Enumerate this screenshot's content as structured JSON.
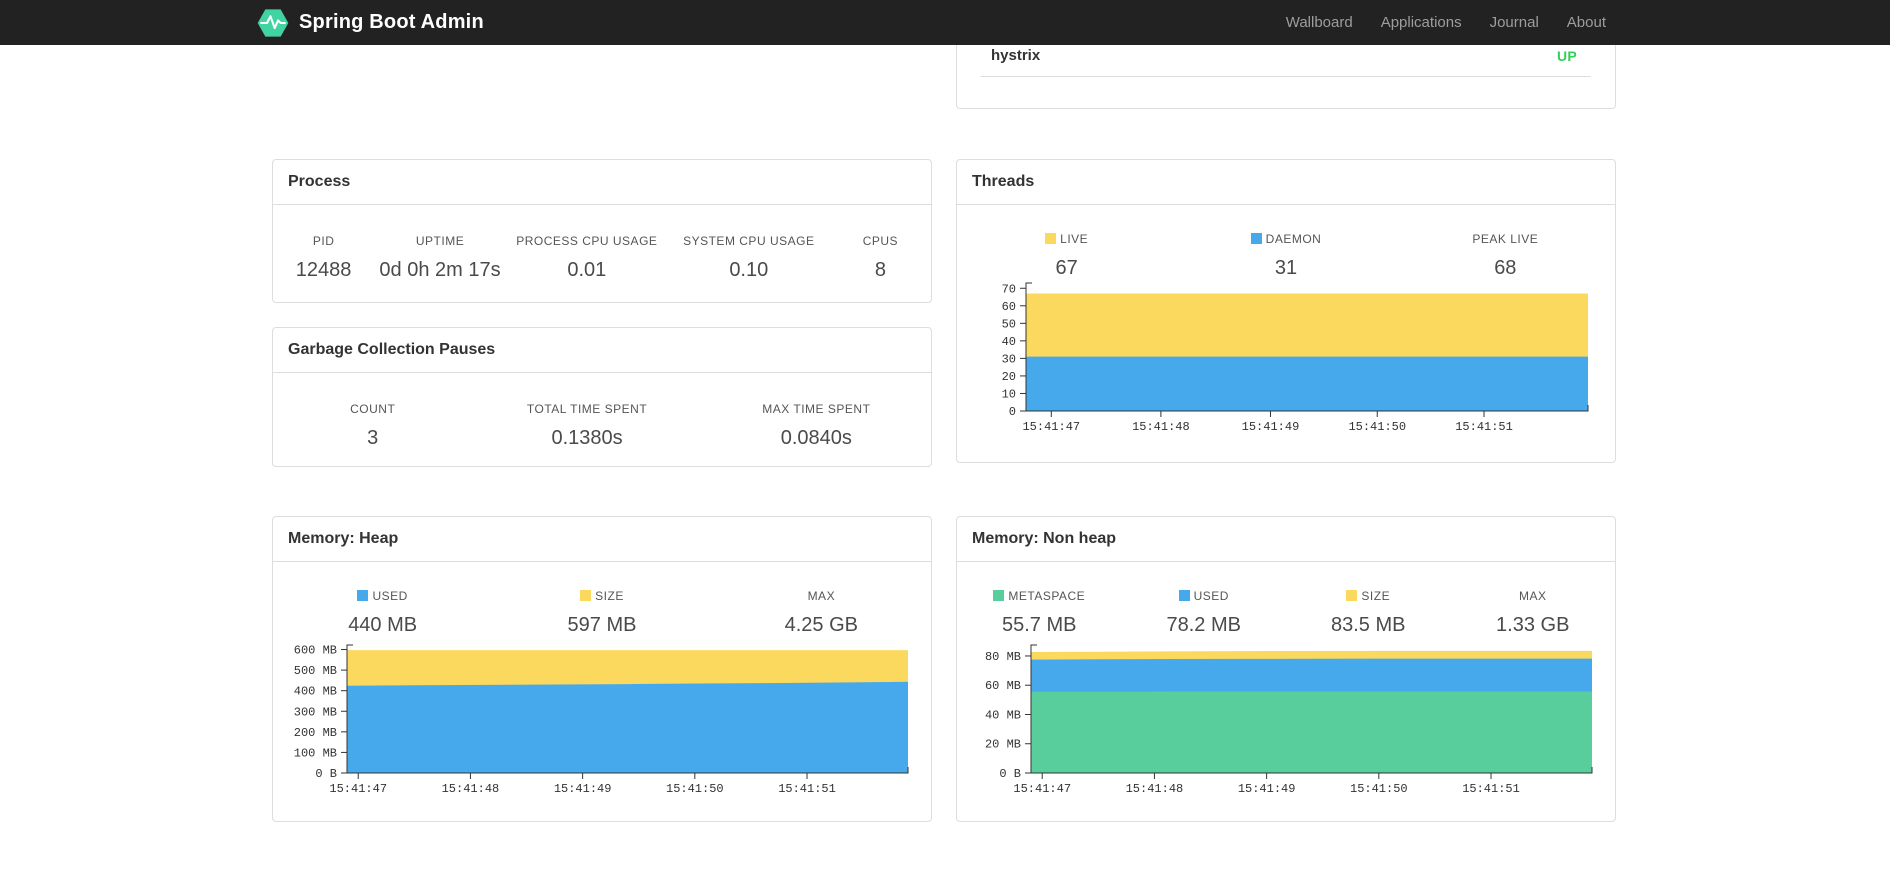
{
  "navbar": {
    "brand": "Spring Boot Admin",
    "items": [
      {
        "label": "Wallboard"
      },
      {
        "label": "Applications"
      },
      {
        "label": "Journal"
      },
      {
        "label": "About"
      }
    ]
  },
  "colors": {
    "navbar_bg": "#222222",
    "brand_green": "#42D3A2",
    "status_up": "#34CE57",
    "chart_yellow": "#FBD95F",
    "chart_blue": "#45A9EC",
    "chart_green": "#57CE9B"
  },
  "health": {
    "name": "hystrix",
    "status": "UP"
  },
  "process": {
    "title": "Process",
    "metrics": [
      {
        "label": "PID",
        "value": "12488"
      },
      {
        "label": "UPTIME",
        "value": "0d 0h 2m 17s"
      },
      {
        "label": "PROCESS CPU USAGE",
        "value": "0.01"
      },
      {
        "label": "SYSTEM CPU USAGE",
        "value": "0.10"
      },
      {
        "label": "CPUS",
        "value": "8"
      }
    ]
  },
  "gc": {
    "title": "Garbage Collection Pauses",
    "metrics": [
      {
        "label": "COUNT",
        "value": "3"
      },
      {
        "label": "TOTAL TIME SPENT",
        "value": "0.1380s"
      },
      {
        "label": "MAX TIME SPENT",
        "value": "0.0840s"
      }
    ]
  },
  "threads": {
    "title": "Threads",
    "metrics": [
      {
        "label": "LIVE",
        "value": "67",
        "swatch": "#FBD95F"
      },
      {
        "label": "DAEMON",
        "value": "31",
        "swatch": "#45A9EC"
      },
      {
        "label": "PEAK LIVE",
        "value": "68"
      }
    ]
  },
  "heap": {
    "title": "Memory: Heap",
    "metrics": [
      {
        "label": "USED",
        "value": "440 MB",
        "swatch": "#45A9EC"
      },
      {
        "label": "SIZE",
        "value": "597 MB",
        "swatch": "#FBD95F"
      },
      {
        "label": "MAX",
        "value": "4.25 GB"
      }
    ]
  },
  "nonheap": {
    "title": "Memory: Non heap",
    "metrics": [
      {
        "label": "METASPACE",
        "value": "55.7 MB",
        "swatch": "#57CE9B"
      },
      {
        "label": "USED",
        "value": "78.2 MB",
        "swatch": "#45A9EC"
      },
      {
        "label": "SIZE",
        "value": "83.5 MB",
        "swatch": "#FBD95F"
      },
      {
        "label": "MAX",
        "value": "1.33 GB"
      }
    ]
  },
  "chart_data": [
    {
      "name": "threads",
      "type": "area",
      "title": "Threads",
      "legend": [
        "LIVE",
        "DAEMON",
        "PEAK LIVE"
      ],
      "legend_position": "top",
      "grid": false,
      "ylim": [
        0,
        73
      ],
      "layout": {
        "ml": 69,
        "mr": 27,
        "pt": 13,
        "ph": 128
      },
      "x_ticks": [
        {
          "f": 0.045,
          "label": "15:41:47"
        },
        {
          "f": 0.24,
          "label": "15:41:48"
        },
        {
          "f": 0.435,
          "label": "15:41:49"
        },
        {
          "f": 0.625,
          "label": "15:41:50"
        },
        {
          "f": 0.815,
          "label": "15:41:51"
        }
      ],
      "y_ticks": [
        {
          "v": 0,
          "label": "0"
        },
        {
          "v": 10,
          "label": "10"
        },
        {
          "v": 20,
          "label": "20"
        },
        {
          "v": 30,
          "label": "30"
        },
        {
          "v": 40,
          "label": "40"
        },
        {
          "v": 50,
          "label": "50"
        },
        {
          "v": 60,
          "label": "60"
        },
        {
          "v": 70,
          "label": "70"
        }
      ],
      "series": [
        {
          "name": "LIVE",
          "color": "#FBD95F",
          "values": [
            67,
            67,
            67,
            67,
            67,
            67,
            67,
            67,
            67
          ]
        },
        {
          "name": "DAEMON",
          "color": "#45A9EC",
          "values": [
            31,
            31,
            31,
            31,
            31,
            31,
            31,
            31,
            31
          ]
        }
      ]
    },
    {
      "name": "memory-heap",
      "type": "area",
      "title": "Memory: Heap",
      "legend": [
        "USED",
        "SIZE",
        "MAX"
      ],
      "legend_position": "top",
      "grid": false,
      "ylim": [
        0,
        622
      ],
      "units": "MB",
      "layout": {
        "ml": 74,
        "mr": 23,
        "pt": 13,
        "ph": 128
      },
      "x_ticks": [
        {
          "f": 0.02,
          "label": "15:41:47"
        },
        {
          "f": 0.22,
          "label": "15:41:48"
        },
        {
          "f": 0.42,
          "label": "15:41:49"
        },
        {
          "f": 0.62,
          "label": "15:41:50"
        },
        {
          "f": 0.82,
          "label": "15:41:51"
        }
      ],
      "y_ticks": [
        {
          "v": 0,
          "label": "0 B"
        },
        {
          "v": 100,
          "label": "100 MB"
        },
        {
          "v": 200,
          "label": "200 MB"
        },
        {
          "v": 300,
          "label": "300 MB"
        },
        {
          "v": 400,
          "label": "400 MB"
        },
        {
          "v": 500,
          "label": "500 MB"
        },
        {
          "v": 600,
          "label": "600 MB"
        }
      ],
      "series": [
        {
          "name": "SIZE",
          "color": "#FBD95F",
          "values": [
            597,
            597,
            597,
            597,
            597,
            597,
            597,
            597,
            597
          ]
        },
        {
          "name": "USED",
          "color": "#45A9EC",
          "values": [
            424,
            426,
            428,
            430,
            432,
            435,
            437,
            440,
            443
          ]
        }
      ]
    },
    {
      "name": "memory-nonheap",
      "type": "area",
      "title": "Memory: Non heap",
      "legend": [
        "METASPACE",
        "USED",
        "SIZE",
        "MAX"
      ],
      "legend_position": "top",
      "grid": false,
      "ylim": [
        0,
        87.5
      ],
      "units": "MB",
      "layout": {
        "ml": 74,
        "mr": 23,
        "pt": 13,
        "ph": 128
      },
      "x_ticks": [
        {
          "f": 0.02,
          "label": "15:41:47"
        },
        {
          "f": 0.22,
          "label": "15:41:48"
        },
        {
          "f": 0.42,
          "label": "15:41:49"
        },
        {
          "f": 0.62,
          "label": "15:41:50"
        },
        {
          "f": 0.82,
          "label": "15:41:51"
        }
      ],
      "y_ticks": [
        {
          "v": 0,
          "label": "0 B"
        },
        {
          "v": 20,
          "label": "20 MB"
        },
        {
          "v": 40,
          "label": "40 MB"
        },
        {
          "v": 60,
          "label": "60 MB"
        },
        {
          "v": 80,
          "label": "80 MB"
        }
      ],
      "series": [
        {
          "name": "SIZE",
          "color": "#FBD95F",
          "values": [
            82.7,
            82.9,
            83.1,
            83.3,
            83.4,
            83.5,
            83.5,
            83.5,
            83.5
          ]
        },
        {
          "name": "USED",
          "color": "#45A9EC",
          "values": [
            77.5,
            77.7,
            77.9,
            78.0,
            78.1,
            78.2,
            78.2,
            78.2,
            78.2
          ]
        },
        {
          "name": "METASPACE",
          "color": "#57CE9B",
          "values": [
            55.5,
            55.6,
            55.7,
            55.7,
            55.7,
            55.7,
            55.7,
            55.7,
            55.7
          ]
        }
      ]
    }
  ]
}
